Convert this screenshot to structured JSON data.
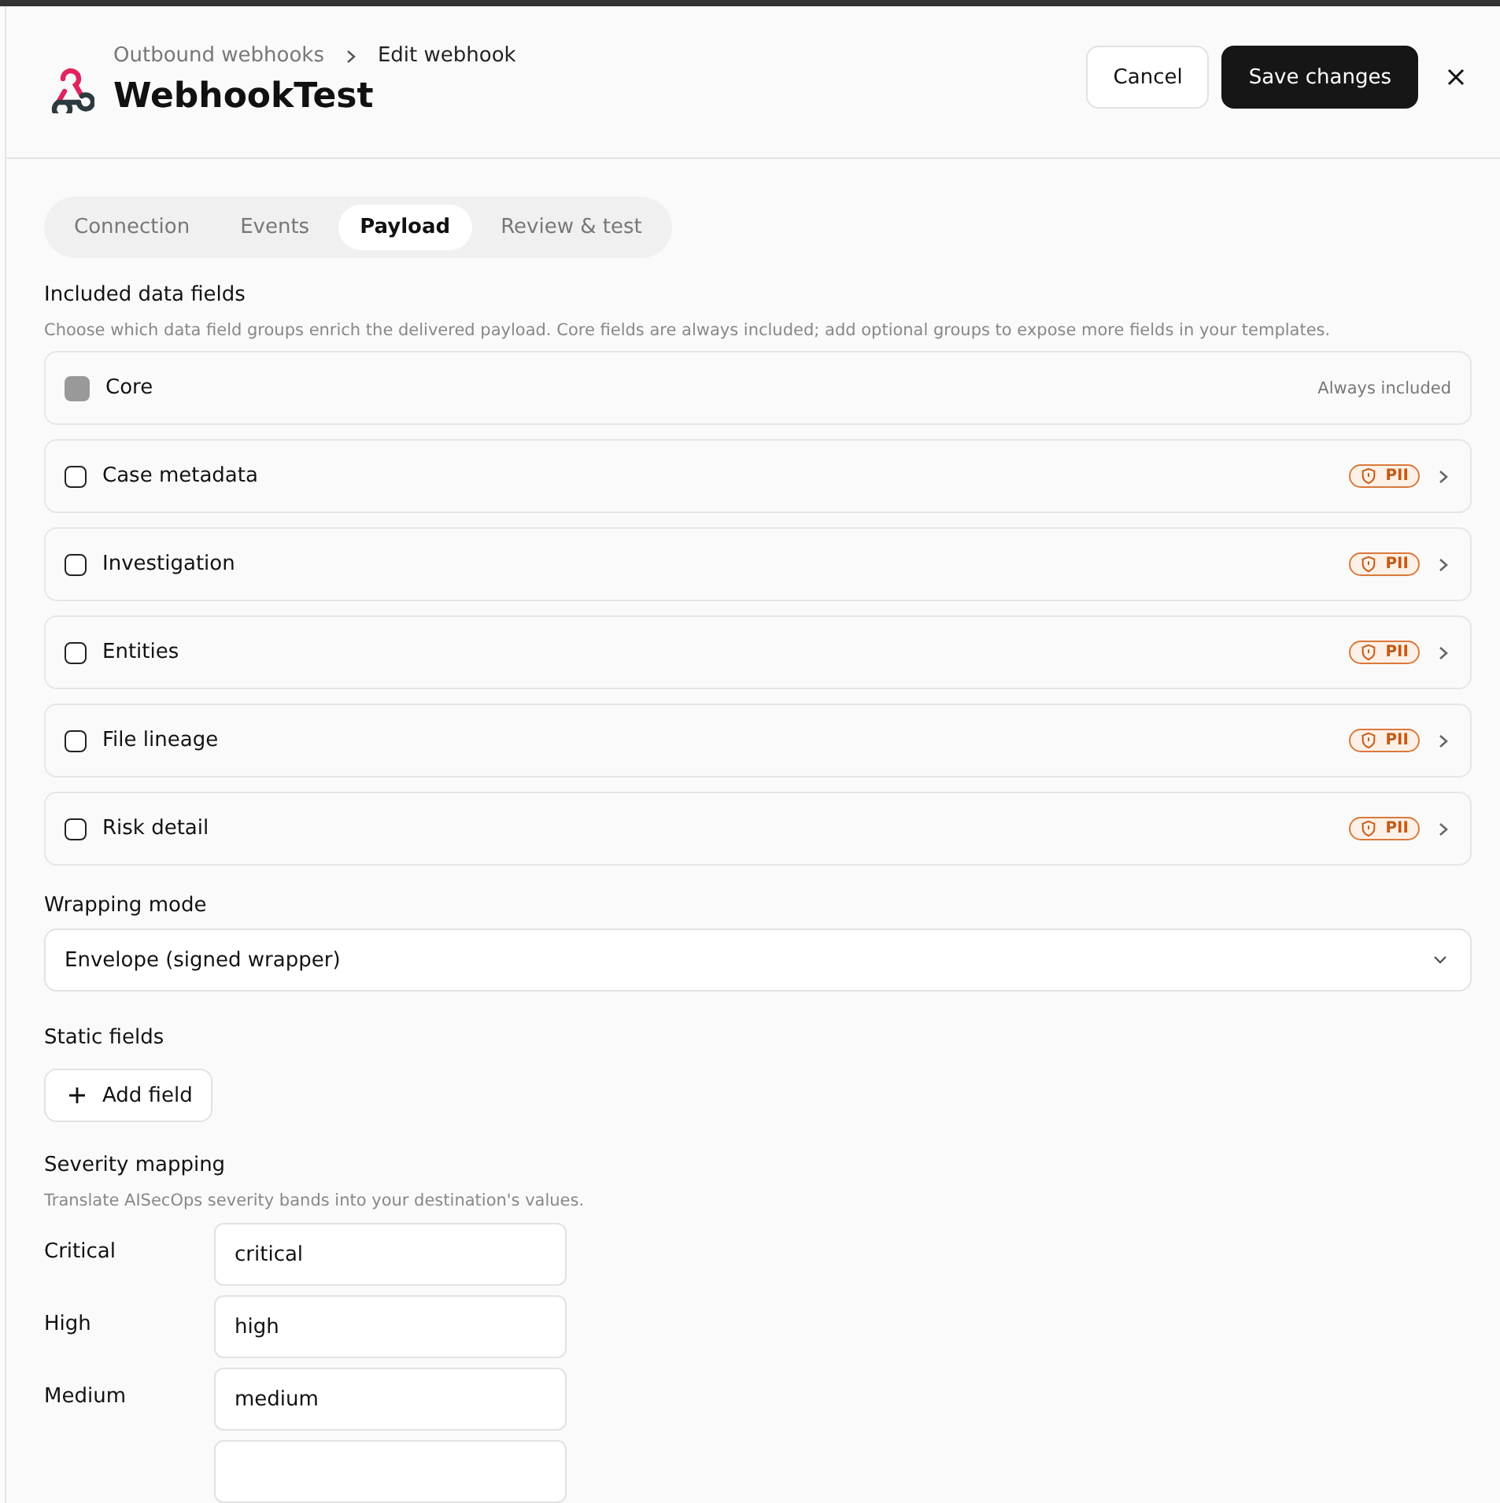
{
  "breadcrumb": [
    {
      "label": "Outbound webhooks"
    },
    {
      "label": "Edit webhook"
    }
  ],
  "title": "WebhookTest",
  "actions": {
    "cancel": "Cancel",
    "save": "Save changes"
  },
  "tabs": [
    {
      "label": "Connection",
      "selected": false
    },
    {
      "label": "Events",
      "selected": false
    },
    {
      "label": "Payload",
      "selected": true
    },
    {
      "label": "Review & test",
      "selected": false
    }
  ],
  "data_fields": {
    "heading": "Included data fields",
    "description": "Choose which data field groups enrich the delivered payload. Core fields are always included; add optional groups to expose more fields in your templates.",
    "groups": [
      {
        "name": "Core",
        "kind": "locked",
        "checked": true,
        "note": "Always included"
      },
      {
        "name": "Case metadata",
        "kind": "optional",
        "checked": false,
        "badge": "PII"
      },
      {
        "name": "Investigation",
        "kind": "optional",
        "checked": false,
        "badge": "PII"
      },
      {
        "name": "Entities",
        "kind": "optional",
        "checked": false,
        "badge": "PII"
      },
      {
        "name": "File lineage",
        "kind": "optional",
        "checked": false,
        "badge": "PII"
      },
      {
        "name": "Risk detail",
        "kind": "optional",
        "checked": false,
        "badge": "PII"
      }
    ]
  },
  "wrapping_mode": {
    "label": "Wrapping mode",
    "value": "Envelope (signed wrapper)"
  },
  "static_fields": {
    "label": "Static fields",
    "button": "Add field"
  },
  "severity_mapping": {
    "heading": "Severity mapping",
    "description": "Translate AISecOps severity bands into your destination's values.",
    "rows": [
      {
        "label": "Critical",
        "value": "critical"
      },
      {
        "label": "High",
        "value": "high"
      },
      {
        "label": "Medium",
        "value": "medium"
      }
    ]
  }
}
